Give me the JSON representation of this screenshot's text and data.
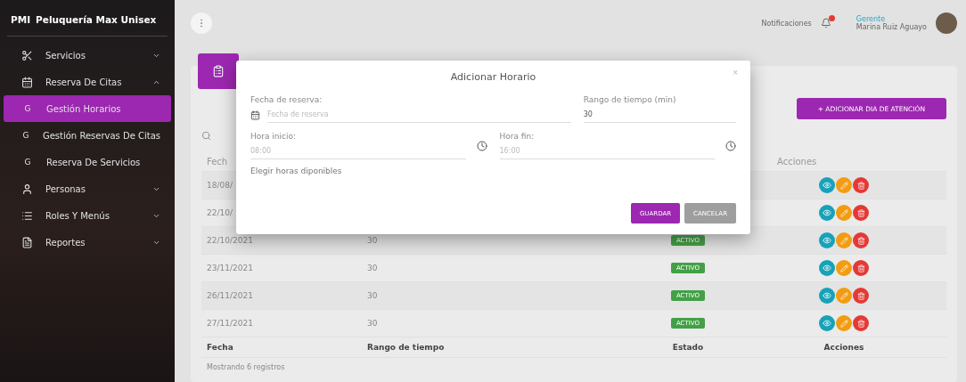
{
  "sidebar": {
    "brand_short": "PMI",
    "brand": "Peluquería Max Unisex",
    "items": [
      {
        "kind": "section",
        "label": "Servicios",
        "expanded": false,
        "selected": false
      },
      {
        "kind": "section",
        "label": "Reserva De Citas",
        "expanded": true,
        "selected": false
      },
      {
        "kind": "sub",
        "abbr": "G",
        "label": "Gestión Horarios",
        "selected": true
      },
      {
        "kind": "sub",
        "abbr": "G",
        "label": "Gestión Reservas De Citas",
        "selected": false
      },
      {
        "kind": "sub",
        "abbr": "G",
        "label": "Reserva De Servicios",
        "selected": false
      },
      {
        "kind": "section",
        "label": "Personas",
        "expanded": false,
        "selected": false
      },
      {
        "kind": "section",
        "label": "Roles Y Menús",
        "expanded": false,
        "selected": false
      },
      {
        "kind": "section",
        "label": "Reportes",
        "expanded": false,
        "selected": false
      }
    ]
  },
  "topbar": {
    "notifications": "Notificaciones",
    "role": "Gerente",
    "user": "Marina Ruiz Aguayo"
  },
  "card": {
    "add_button": "+ ADICIONAR DIA DE ATENCIÓN",
    "table": {
      "header": [
        "Fech",
        "Acciones"
      ],
      "rows": [
        {
          "fecha": "18/08/"
        },
        {
          "fecha": "22/10/"
        },
        {
          "fecha": "22/10/2021",
          "rango": "30",
          "estado": "ACTIVO"
        },
        {
          "fecha": "23/11/2021",
          "rango": "30",
          "estado": "ACTIVO"
        },
        {
          "fecha": "26/11/2021",
          "rango": "30",
          "estado": "ACTIVO"
        },
        {
          "fecha": "27/11/2021",
          "rango": "30",
          "estado": "ACTIVO"
        }
      ],
      "footer": [
        "Fecha",
        "Rango de tiempo",
        "Estado",
        "Acciones"
      ]
    },
    "info": "Mostrando 6 registros"
  },
  "modal": {
    "title": "Adicionar Horario",
    "close": "×",
    "fecha_label": "Fecha de reserva:",
    "fecha_placeholder": "Fecha de reserva",
    "rango_label": "Rango de tiempo (min)",
    "rango_value": "30",
    "inicio_label": "Hora inicio:",
    "inicio_placeholder": "08:00",
    "fin_label": "Hora fin:",
    "fin_placeholder": "16:00",
    "hint": "Elegir horas diponibles",
    "buttons": [
      "GUARDAR",
      "CANCELAR"
    ]
  }
}
